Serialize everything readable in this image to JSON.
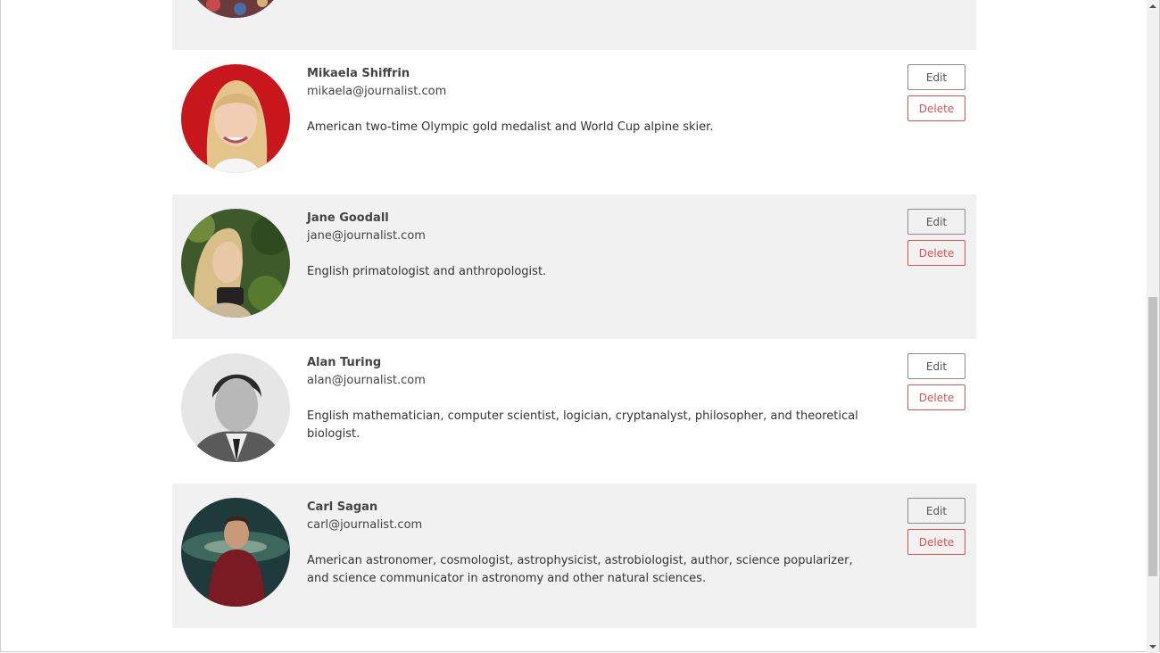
{
  "profiles": [
    {
      "name": "Mikaela Shiffrin",
      "email": "mikaela@journalist.com",
      "bio": "American two-time Olympic gold medalist and World Cup alpine skier.",
      "edit_label": "Edit",
      "delete_label": "Delete"
    },
    {
      "name": "Jane Goodall",
      "email": "jane@journalist.com",
      "bio": "English primatologist and anthropologist.",
      "edit_label": "Edit",
      "delete_label": "Delete"
    },
    {
      "name": "Alan Turing",
      "email": "alan@journalist.com",
      "bio": "English mathematician, computer scientist, logician, cryptanalyst, philosopher, and theoretical biologist.",
      "edit_label": "Edit",
      "delete_label": "Delete"
    },
    {
      "name": "Carl Sagan",
      "email": "carl@journalist.com",
      "bio": "American astronomer, cosmologist, astrophysicist, astrobiologist, author, science popularizer, and science communicator in astronomy and other natural sciences.",
      "edit_label": "Edit",
      "delete_label": "Delete"
    }
  ],
  "colors": {
    "row_shade": "#f1f1f1",
    "delete": "#d9534f",
    "edit_border": "#8a8a8a"
  }
}
